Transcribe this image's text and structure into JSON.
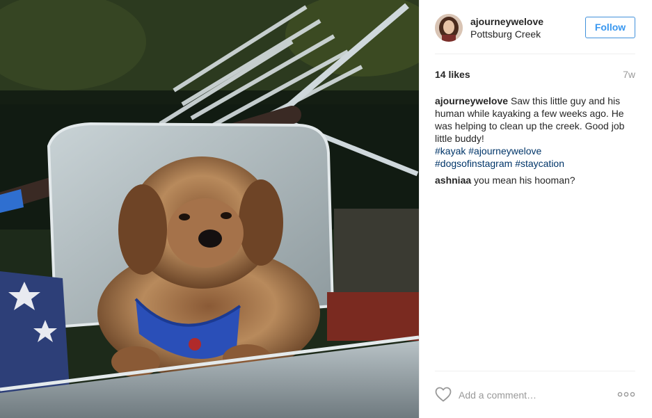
{
  "post": {
    "username": "ajourneywelove",
    "location": "Pottsburg Creek",
    "follow_label": "Follow",
    "likes": "14 likes",
    "age": "7w"
  },
  "caption": {
    "username": "ajourneywelove",
    "text": "Saw this little guy and his human while kayaking a few weeks ago. He was helping to clean up the creek. Good job little buddy!",
    "hashtags": [
      "#kayak",
      "#ajourneywelove",
      "#dogsofinstagram",
      "#staycation"
    ]
  },
  "comments": [
    {
      "username": "ashniaa",
      "text": "you mean his hooman?"
    }
  ],
  "footer": {
    "comment_placeholder": "Add a comment…"
  },
  "colors": {
    "accent": "#3897f0",
    "hashtag": "#003569",
    "muted": "#999999",
    "harness": "#2a4fb8"
  },
  "icons": {
    "like": "heart-outline-icon",
    "more": "more-options-icon"
  }
}
